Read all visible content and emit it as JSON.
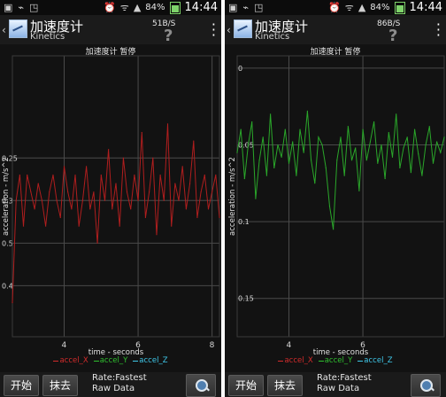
{
  "screens": [
    {
      "status": {
        "speed": "51B/S",
        "battery": "84%",
        "time": "14:44"
      },
      "app": {
        "title": "加速度计",
        "subtitle": "Kinetics",
        "help": "?"
      },
      "chart_caption": "加速度计 暂停",
      "toolbar": {
        "start": "开始",
        "clear": "抹去",
        "rate": "Rate:Fastest",
        "raw": "Raw Data"
      },
      "chart_data": {
        "type": "line",
        "ylabel": "acceleration - m/s^2",
        "xlabel": "time - seconds",
        "xlim": [
          2.6,
          8.2
        ],
        "ylim": [
          -0.46,
          -0.13
        ],
        "xticks": [
          4,
          6,
          8
        ],
        "yticks": [
          -0.25,
          -0.3,
          -0.35,
          -0.4
        ],
        "ytick_labels": [
          "0.25",
          "0.3",
          "0.5",
          "0.4"
        ],
        "ytick_side": "left",
        "grid": true,
        "legend": [
          "accel_X",
          "accel_Y",
          "accel_Z"
        ],
        "colors": {
          "accel_X": "#d22b2b",
          "accel_Y": "#2fbf2f",
          "accel_Z": "#3fc7e8"
        },
        "series": [
          {
            "name": "accel_X",
            "color": "#b01e1e",
            "x": [
              2.6,
              2.7,
              2.8,
              2.9,
              3.0,
              3.1,
              3.2,
              3.3,
              3.4,
              3.5,
              3.6,
              3.7,
              3.8,
              3.9,
              4.0,
              4.1,
              4.2,
              4.3,
              4.4,
              4.5,
              4.6,
              4.7,
              4.8,
              4.9,
              5.0,
              5.1,
              5.2,
              5.3,
              5.4,
              5.5,
              5.6,
              5.7,
              5.8,
              5.9,
              6.0,
              6.1,
              6.2,
              6.3,
              6.4,
              6.5,
              6.6,
              6.7,
              6.8,
              6.9,
              7.0,
              7.1,
              7.2,
              7.3,
              7.4,
              7.5,
              7.6,
              7.7,
              7.8,
              7.9,
              8.0,
              8.1,
              8.2
            ],
            "y": [
              -0.42,
              -0.3,
              -0.27,
              -0.33,
              -0.27,
              -0.29,
              -0.31,
              -0.28,
              -0.3,
              -0.33,
              -0.29,
              -0.27,
              -0.3,
              -0.32,
              -0.26,
              -0.29,
              -0.31,
              -0.27,
              -0.33,
              -0.3,
              -0.26,
              -0.31,
              -0.29,
              -0.35,
              -0.27,
              -0.3,
              -0.24,
              -0.31,
              -0.28,
              -0.33,
              -0.25,
              -0.29,
              -0.31,
              -0.27,
              -0.3,
              -0.22,
              -0.32,
              -0.29,
              -0.25,
              -0.34,
              -0.27,
              -0.3,
              -0.21,
              -0.33,
              -0.28,
              -0.3,
              -0.26,
              -0.31,
              -0.28,
              -0.23,
              -0.32,
              -0.29,
              -0.27,
              -0.31,
              -0.29,
              -0.27,
              -0.32
            ]
          }
        ]
      }
    },
    {
      "status": {
        "speed": "86B/S",
        "battery": "84%",
        "time": "14:44"
      },
      "app": {
        "title": "加速度计",
        "subtitle": "Kinetics",
        "help": "?"
      },
      "chart_caption": "加速度计 暂停",
      "toolbar": {
        "start": "开始",
        "clear": "抹去",
        "rate": "Rate:Fastest",
        "raw": "Raw Data"
      },
      "chart_data": {
        "type": "line",
        "ylabel": "acceleration - m/s^2",
        "xlabel": "time - seconds",
        "xlim": [
          2.6,
          8.2
        ],
        "ylim": [
          -0.175,
          0.008
        ],
        "xticks": [
          4,
          6
        ],
        "yticks": [
          0,
          -0.05,
          -0.1,
          -0.15
        ],
        "ytick_labels": [
          "0",
          "0.05",
          "0.1",
          "0.15"
        ],
        "ytick_side": "right",
        "grid": true,
        "legend": [
          "accel_X",
          "accel_Y",
          "accel_Z"
        ],
        "colors": {
          "accel_X": "#d22b2b",
          "accel_Y": "#2fbf2f",
          "accel_Z": "#3fc7e8"
        },
        "series": [
          {
            "name": "accel_Y",
            "color": "#2aa72a",
            "x": [
              2.6,
              2.7,
              2.8,
              2.9,
              3.0,
              3.1,
              3.2,
              3.3,
              3.4,
              3.5,
              3.6,
              3.7,
              3.8,
              3.9,
              4.0,
              4.1,
              4.2,
              4.3,
              4.4,
              4.5,
              4.6,
              4.7,
              4.8,
              4.9,
              5.0,
              5.1,
              5.2,
              5.3,
              5.4,
              5.5,
              5.6,
              5.7,
              5.8,
              5.9,
              6.0,
              6.1,
              6.2,
              6.3,
              6.4,
              6.5,
              6.6,
              6.7,
              6.8,
              6.9,
              7.0,
              7.1,
              7.2,
              7.3,
              7.4,
              7.5,
              7.6,
              7.7,
              7.8,
              7.9,
              8.0,
              8.1,
              8.2
            ],
            "y": [
              -0.055,
              -0.04,
              -0.072,
              -0.05,
              -0.035,
              -0.085,
              -0.06,
              -0.045,
              -0.07,
              -0.03,
              -0.065,
              -0.05,
              -0.058,
              -0.04,
              -0.062,
              -0.048,
              -0.07,
              -0.04,
              -0.055,
              -0.028,
              -0.06,
              -0.075,
              -0.045,
              -0.05,
              -0.065,
              -0.09,
              -0.105,
              -0.06,
              -0.045,
              -0.07,
              -0.038,
              -0.06,
              -0.052,
              -0.08,
              -0.04,
              -0.06,
              -0.048,
              -0.035,
              -0.062,
              -0.05,
              -0.072,
              -0.042,
              -0.058,
              -0.03,
              -0.065,
              -0.052,
              -0.045,
              -0.068,
              -0.04,
              -0.056,
              -0.07,
              -0.05,
              -0.038,
              -0.062,
              -0.048,
              -0.055,
              -0.045
            ]
          }
        ]
      }
    }
  ]
}
